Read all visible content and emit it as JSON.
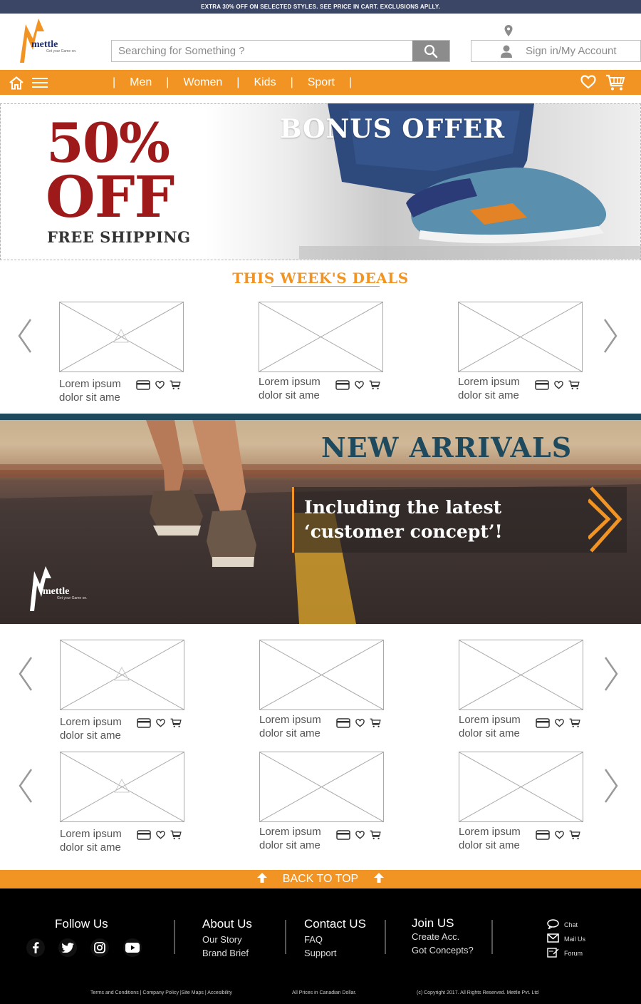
{
  "promo_text": "EXTRA 30% OFF ON SELECTED STYLES.  SEE PRICE IN CART.  EXCLUSIONS APLLY.",
  "header": {
    "logo_word": "mettle",
    "logo_tagline": "Get your Game on.",
    "search_placeholder": "Searching for Something ?",
    "account_label": "Sign in/My Account"
  },
  "nav": {
    "items": [
      {
        "label": "Men"
      },
      {
        "label": "Women"
      },
      {
        "label": "Kids"
      },
      {
        "label": "Sport"
      }
    ]
  },
  "hero": {
    "discount": "50%",
    "off": "OFF",
    "shipping": "FREE SHIPPING",
    "headline": "BONUS OFFER"
  },
  "deals": {
    "title": "THIS WEEK'S DEALS",
    "products": [
      {
        "name": "Lorem ipsum dolor sit ame"
      },
      {
        "name": "Lorem ipsum dolor sit ame"
      },
      {
        "name": "Lorem ipsum dolor sit ame"
      }
    ]
  },
  "arrivals": {
    "title": "NEW ARRIVALS",
    "subtitle_line1": "Including the latest",
    "subtitle_line2": "‘customer concept’!",
    "logo_word": "mettle",
    "logo_tagline": "Get your Game on.",
    "products": [
      {
        "name": "Lorem ipsum dolor sit ame"
      },
      {
        "name": "Lorem ipsum dolor sit ame"
      },
      {
        "name": "Lorem ipsum dolor sit ame"
      },
      {
        "name": "Lorem ipsum dolor sit ame"
      },
      {
        "name": "Lorem ipsum dolor sit ame"
      },
      {
        "name": "Lorem ipsum dolor sit ame"
      }
    ]
  },
  "back_to_top": "BACK TO TOP",
  "footer": {
    "follow": "Follow Us",
    "about": {
      "title": "About Us",
      "links": [
        "Our Story",
        "Brand Brief"
      ]
    },
    "contact": {
      "title": "Contact US",
      "links": [
        "FAQ",
        "Support"
      ]
    },
    "join": {
      "title": "Join US",
      "links": [
        "Create Acc.",
        "Got Concepts?"
      ]
    },
    "contact_options": [
      "Chat",
      "Mail Us",
      "Forum"
    ],
    "legal": "Terms and Conditions | Company Policy |Site Maps | Accesibility",
    "currency": "All Prices in Canadian Dollar.",
    "copyright": "(c) Copyright 2017. All Rights Reserved. Mettle Pvt. Ltd"
  },
  "colors": {
    "accent": "#f29423",
    "promo_bg": "#3b4565",
    "hero_red": "#9e1a1a",
    "arrivals_blue": "#1f4a5e",
    "footer_bg": "#000000"
  },
  "icons": [
    "location-pin-icon",
    "search-icon",
    "user-icon",
    "home-icon",
    "menu-icon",
    "heart-icon",
    "cart-icon",
    "card-icon",
    "arrow-left-icon",
    "arrow-right-icon",
    "chevron-right-icon",
    "arrow-up-icon",
    "facebook-icon",
    "twitter-icon",
    "instagram-icon",
    "youtube-icon",
    "chat-icon",
    "mail-icon",
    "forum-icon"
  ]
}
